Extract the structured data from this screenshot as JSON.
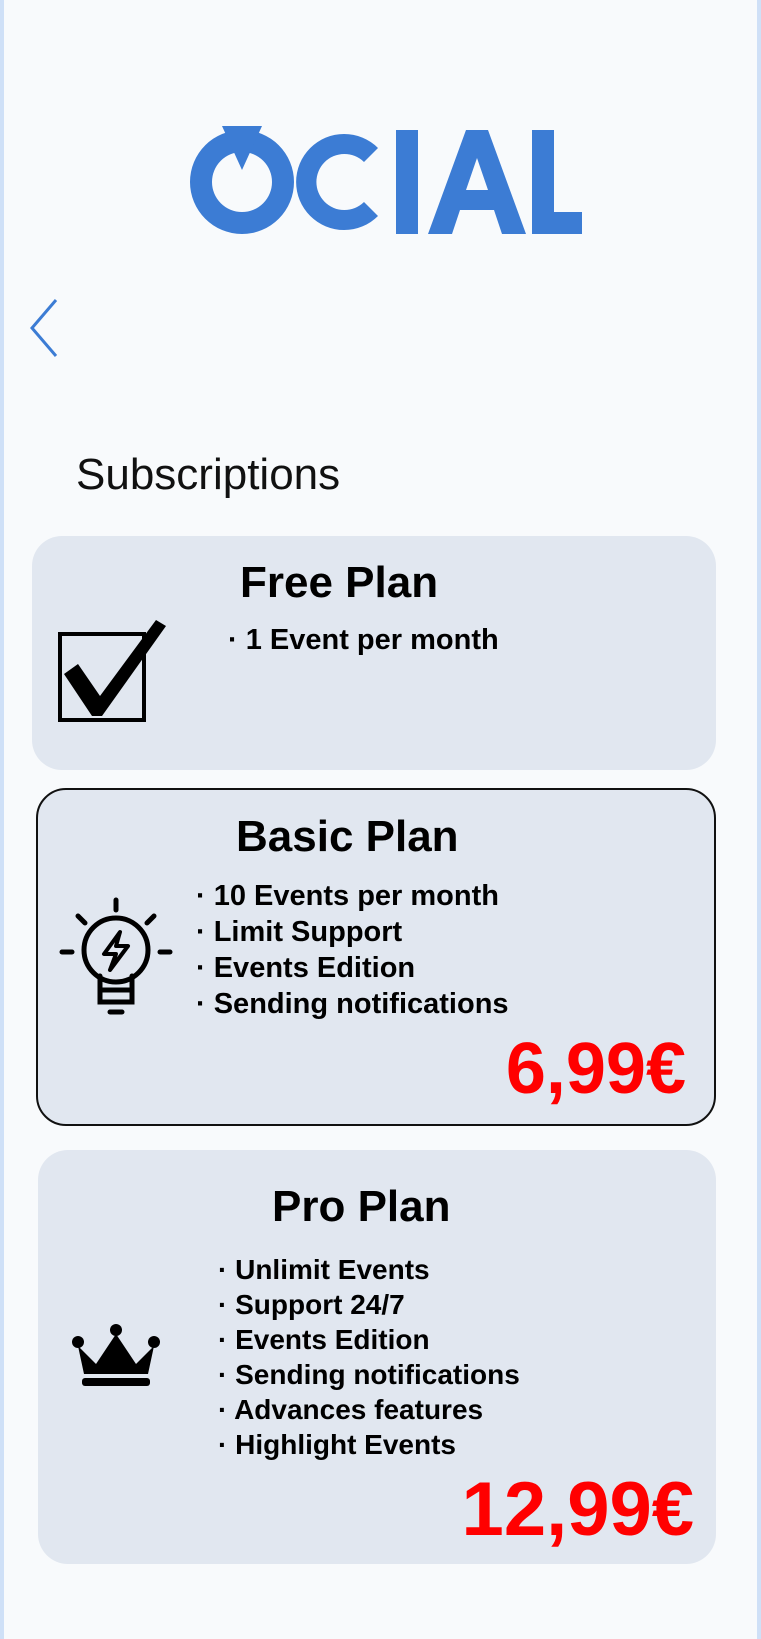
{
  "brand": {
    "logo_text": "OCIAL",
    "color": "#3c7cd4"
  },
  "nav": {
    "back_icon": "chevron-left-icon"
  },
  "page": {
    "title": "Subscriptions"
  },
  "plans": [
    {
      "name": "Free Plan",
      "icon": "checkbox-checked-icon",
      "features": [
        "1 Event per month"
      ]
    },
    {
      "name": "Basic Plan",
      "icon": "lightbulb-icon",
      "features": [
        "10 Events per month",
        "Limit Support",
        "Events Edition",
        "Sending notifications"
      ],
      "price": "6,99€"
    },
    {
      "name": "Pro Plan",
      "icon": "crown-icon",
      "features": [
        "Unlimit Events",
        "Support 24/7",
        "Events Edition",
        "Sending notifications",
        "Advances features",
        "Highlight Events"
      ],
      "price": "12,99€"
    }
  ],
  "colors": {
    "price": "#ff0000",
    "card_bg": "#e1e7f0",
    "page_bg": "#f8fafc",
    "frame": "#cfe0f7"
  }
}
